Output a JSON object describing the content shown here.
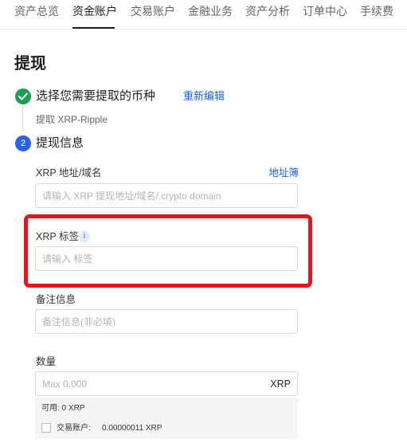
{
  "nav": {
    "tabs": [
      {
        "label": "资产总览",
        "active": false
      },
      {
        "label": "资金账户",
        "active": true
      },
      {
        "label": "交易账户",
        "active": false
      },
      {
        "label": "金融业务",
        "active": false
      },
      {
        "label": "资产分析",
        "active": false
      },
      {
        "label": "订单中心",
        "active": false
      },
      {
        "label": "手续费",
        "active": false
      }
    ]
  },
  "page": {
    "title": "提现"
  },
  "steps": {
    "step1": {
      "title": "选择您需要提取的币种",
      "edit_label": "重新编辑",
      "summary": "提取 XRP-Ripple",
      "icon": "check-icon"
    },
    "step2": {
      "number": "2",
      "title": "提现信息"
    }
  },
  "form": {
    "address": {
      "label": "XRP 地址/域名",
      "link": "地址簿",
      "placeholder": "请输入 XRP 提现地址/域名/.crypto domain",
      "value": ""
    },
    "tag": {
      "label": "XRP 标签",
      "info_icon": "i",
      "placeholder": "请输入 标签",
      "value": ""
    },
    "remark": {
      "label": "备注信息",
      "placeholder": "备注信息(非必填)",
      "value": ""
    },
    "amount": {
      "label": "数量",
      "placeholder": "Max 0.000",
      "unit": "XRP",
      "value": ""
    }
  },
  "balance": {
    "available": "可用:  0 XRP",
    "trading_label": "交易账户:",
    "trading_value": "0.00000011 XRP"
  },
  "colors": {
    "accent": "#2a62e6",
    "success": "#1e9e52",
    "highlight": "#e8141b",
    "link": "#1a5fd6"
  }
}
